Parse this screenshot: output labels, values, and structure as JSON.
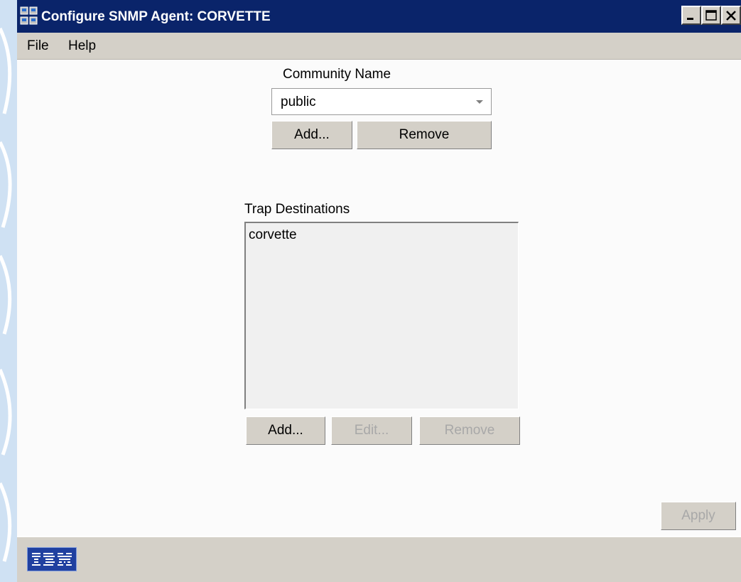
{
  "window": {
    "title": "Configure SNMP Agent: CORVETTE"
  },
  "menu": {
    "file": "File",
    "help": "Help"
  },
  "community": {
    "label": "Community Name",
    "selected": "public",
    "add_label": "Add...",
    "remove_label": "Remove"
  },
  "trap": {
    "label": "Trap Destinations",
    "items": [
      "corvette"
    ],
    "add_label": "Add...",
    "edit_label": "Edit...",
    "remove_label": "Remove"
  },
  "footer": {
    "apply_label": "Apply",
    "logo": "IBM"
  },
  "icons": {
    "app": "network-agent-icon",
    "minimize": "minimize-icon",
    "maximize": "maximize-icon",
    "close": "close-icon",
    "dropdown": "chevron-down-icon"
  },
  "colors": {
    "titlebar": "#0a246a",
    "window": "#d4d0c8",
    "content": "#fbfbfb",
    "logo": "#2040a0"
  }
}
